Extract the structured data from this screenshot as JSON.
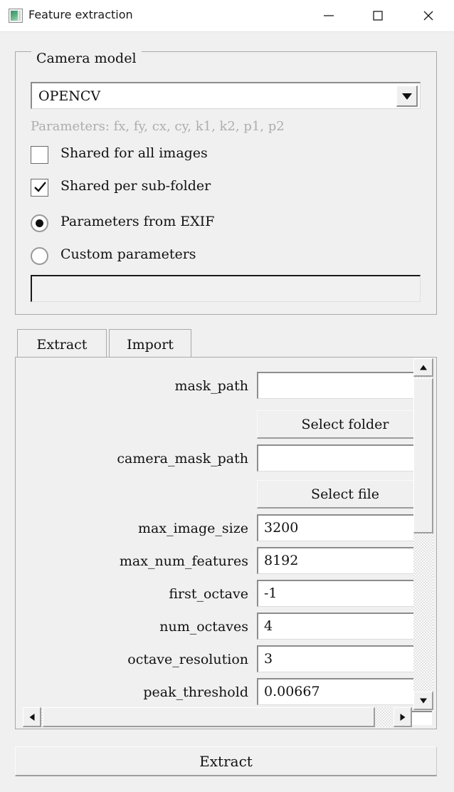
{
  "window": {
    "title": "Feature extraction",
    "icon": "image-app-icon",
    "controls": {
      "minimize": "minimize-icon",
      "maximize": "maximize-icon",
      "close": "close-icon"
    }
  },
  "camera_model": {
    "group_title": "Camera model",
    "selected": "OPENCV",
    "dropdown_icon": "chevron-down-icon",
    "params_hint": "Parameters: fx, fy, cx, cy, k1, k2, p1, p2",
    "options": [
      {
        "label": "Shared for all images",
        "type": "checkbox",
        "checked": false
      },
      {
        "label": "Shared per sub-folder",
        "type": "checkbox",
        "checked": true
      },
      {
        "label": "Parameters from EXIF",
        "type": "radio",
        "checked": true
      },
      {
        "label": "Custom parameters",
        "type": "radio",
        "checked": false
      }
    ],
    "custom_parameters_value": "",
    "custom_parameters_enabled": false
  },
  "tabs": [
    {
      "label": "Extract",
      "active": true
    },
    {
      "label": "Import",
      "active": false
    }
  ],
  "parameters": [
    {
      "label": "mask_path",
      "value": "",
      "kind": "text"
    },
    {
      "label": "",
      "value": "Select folder",
      "kind": "button"
    },
    {
      "label": "camera_mask_path",
      "value": "",
      "kind": "text"
    },
    {
      "label": "",
      "value": "Select file",
      "kind": "button"
    },
    {
      "label": "max_image_size",
      "value": "3200",
      "kind": "spin"
    },
    {
      "label": "max_num_features",
      "value": "8192",
      "kind": "spin"
    },
    {
      "label": "first_octave",
      "value": "-1",
      "kind": "spin"
    },
    {
      "label": "num_octaves",
      "value": "4",
      "kind": "spin"
    },
    {
      "label": "octave_resolution",
      "value": "3",
      "kind": "spin"
    },
    {
      "label": "peak_threshold",
      "value": "0.00667",
      "kind": "spin"
    }
  ],
  "scrollbars": {
    "vertical": {
      "up_icon": "scroll-up-icon",
      "down_icon": "scroll-down-icon"
    },
    "horizontal": {
      "left_icon": "scroll-left-icon",
      "right_icon": "scroll-right-icon"
    }
  },
  "footer": {
    "extract_label": "Extract"
  },
  "colors": {
    "window_background": "#f0f0f0",
    "titlebar_background": "#ffffff",
    "field_background": "#ffffff",
    "border": "#a9a9a9",
    "hint_text": "#adadad",
    "text": "#111111",
    "icon_accent": "#56ad7d"
  }
}
